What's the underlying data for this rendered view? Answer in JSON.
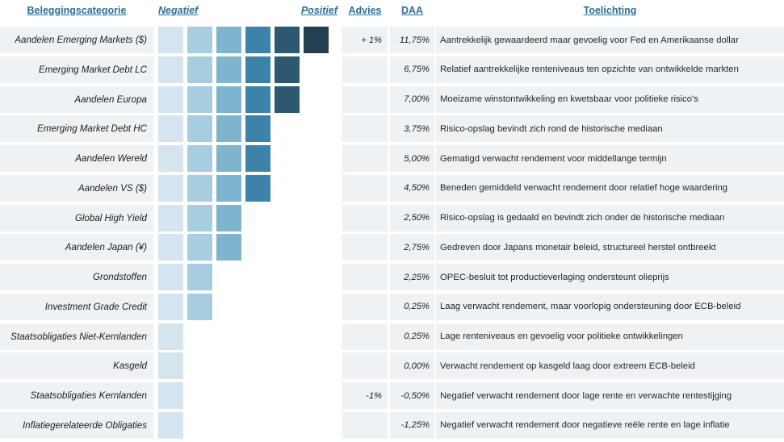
{
  "header": {
    "category": "Beleggingscategorie",
    "negative": "Negatief",
    "positive": "Positief",
    "advies": "Advies",
    "daa": "DAA",
    "toelichting": "Toelichting"
  },
  "palette": {
    "level1": "#d5e5ef",
    "level2": "#a8cde1",
    "level3": "#7fb4ce",
    "level4": "#3d82a8",
    "level5": "#2c5870",
    "level6": "#22404f",
    "cell_background": "#eef2f5",
    "header_text": "#2e6f96",
    "body_text": "#1d1d1d",
    "page_background": "#ffffff"
  },
  "chart_data": {
    "type": "bar",
    "title": "Beleggingscategorie",
    "xlabel": "",
    "ylabel": "",
    "scale_min_label": "Negatief",
    "scale_max_label": "Positief",
    "max_level": 6,
    "categories": [
      "Aandelen Emerging Markets ($)",
      "Emerging Market Debt LC",
      "Aandelen Europa",
      "Emerging Market Debt HC",
      "Aandelen Wereld",
      "Aandelen VS ($)",
      "Global High Yield",
      "Aandelen Japan (¥)",
      "Grondstoffen",
      "Investment Grade Credit",
      "Staatsobligaties Niet-Kernlanden",
      "Kasgeld",
      "Staatsobligaties Kernlanden",
      "Inflatiegerelateerde Obligaties"
    ],
    "values": [
      6,
      5,
      5,
      4,
      4,
      4,
      3,
      3,
      2,
      2,
      1,
      1,
      1,
      1
    ],
    "series": [
      {
        "name": "DAA",
        "values": [
          11.75,
          6.75,
          7.0,
          3.75,
          5.0,
          4.5,
          2.5,
          2.75,
          2.25,
          0.25,
          0.25,
          0.0,
          -0.5,
          -1.25
        ]
      }
    ]
  },
  "rows": [
    {
      "category": "Aandelen Emerging Markets ($)",
      "level": 6,
      "advies": "+ 1%",
      "daa": "11,75%",
      "toelichting": "Aantrekkelijk gewaardeerd maar gevoelig voor Fed en Amerikaanse dollar"
    },
    {
      "category": "Emerging Market Debt LC",
      "level": 5,
      "advies": "",
      "daa": "6,75%",
      "toelichting": "Relatief aantrekkelijke renteniveaus ten opzichte van ontwikkelde markten"
    },
    {
      "category": "Aandelen Europa",
      "level": 5,
      "advies": "",
      "daa": "7,00%",
      "toelichting": "Moeizame winstontwikkeling en kwetsbaar voor politieke risico's"
    },
    {
      "category": "Emerging Market Debt HC",
      "level": 4,
      "advies": "",
      "daa": "3,75%",
      "toelichting": "Risico-opslag bevindt zich rond de historische mediaan"
    },
    {
      "category": "Aandelen Wereld",
      "level": 4,
      "advies": "",
      "daa": "5,00%",
      "toelichting": "Gematigd verwacht rendement voor middellange termijn"
    },
    {
      "category": "Aandelen VS ($)",
      "level": 4,
      "advies": "",
      "daa": "4,50%",
      "toelichting": "Beneden gemiddeld verwacht rendement door relatief hoge waardering"
    },
    {
      "category": "Global High Yield",
      "level": 3,
      "advies": "",
      "daa": "2,50%",
      "toelichting": "Risico-opslag is gedaald en bevindt zich onder de historische mediaan"
    },
    {
      "category": "Aandelen Japan (¥)",
      "level": 3,
      "advies": "",
      "daa": "2,75%",
      "toelichting": "Gedreven door Japans monetair beleid, structureel herstel ontbreekt"
    },
    {
      "category": "Grondstoffen",
      "level": 2,
      "advies": "",
      "daa": "2,25%",
      "toelichting": "OPEC-besluit tot productieverlaging ondersteunt olieprijs"
    },
    {
      "category": "Investment Grade Credit",
      "level": 2,
      "advies": "",
      "daa": "0,25%",
      "toelichting": "Laag verwacht rendement, maar voorlopig ondersteuning door ECB-beleid"
    },
    {
      "category": "Staatsobligaties Niet-Kernlanden",
      "level": 1,
      "advies": "",
      "daa": "0,25%",
      "toelichting": "Lage renteniveaus en gevoelig voor politieke ontwikkelingen"
    },
    {
      "category": "Kasgeld",
      "level": 1,
      "advies": "",
      "daa": "0,00%",
      "toelichting": "Verwacht rendement op kasgeld laag door extreem ECB-beleid"
    },
    {
      "category": "Staatsobligaties Kernlanden",
      "level": 1,
      "advies": "-1%",
      "daa": "-0,50%",
      "toelichting": "Negatief verwacht rendement door lage rente en verwachte rentestijging"
    },
    {
      "category": "Inflatiegerelateerde Obligaties",
      "level": 1,
      "advies": "",
      "daa": "-1,25%",
      "toelichting": "Negatief verwacht rendement door negatieve reële rente en lage inflatie"
    }
  ]
}
